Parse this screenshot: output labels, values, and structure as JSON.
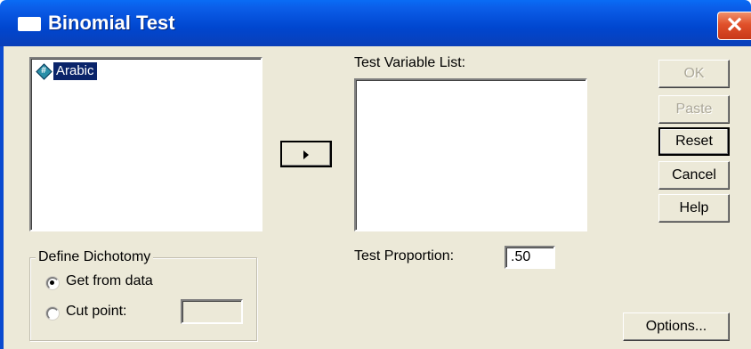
{
  "window": {
    "title": "Binomial Test",
    "close_glyph": "✕"
  },
  "source_list": {
    "items": [
      {
        "label": "Arabic",
        "icon": "numeric-variable-icon",
        "selected": true
      }
    ]
  },
  "move_button": {
    "icon": "right-arrow-icon"
  },
  "test_variable_list": {
    "label": "Test Variable List:",
    "items": []
  },
  "buttons": {
    "ok": "OK",
    "paste": "Paste",
    "reset": "Reset",
    "cancel": "Cancel",
    "help": "Help",
    "options": "Options..."
  },
  "test_proportion": {
    "label": "Test Proportion:",
    "value": ".50"
  },
  "define_dichotomy": {
    "legend": "Define Dichotomy",
    "options": [
      {
        "label": "Get from data",
        "checked": true
      },
      {
        "label": "Cut point:",
        "checked": false
      }
    ],
    "cut_point_value": ""
  },
  "colors": {
    "titlebar": "#0046cf",
    "dialog_background": "#ece9d8",
    "selection": "#0a246a",
    "close_button": "#e0502a"
  }
}
